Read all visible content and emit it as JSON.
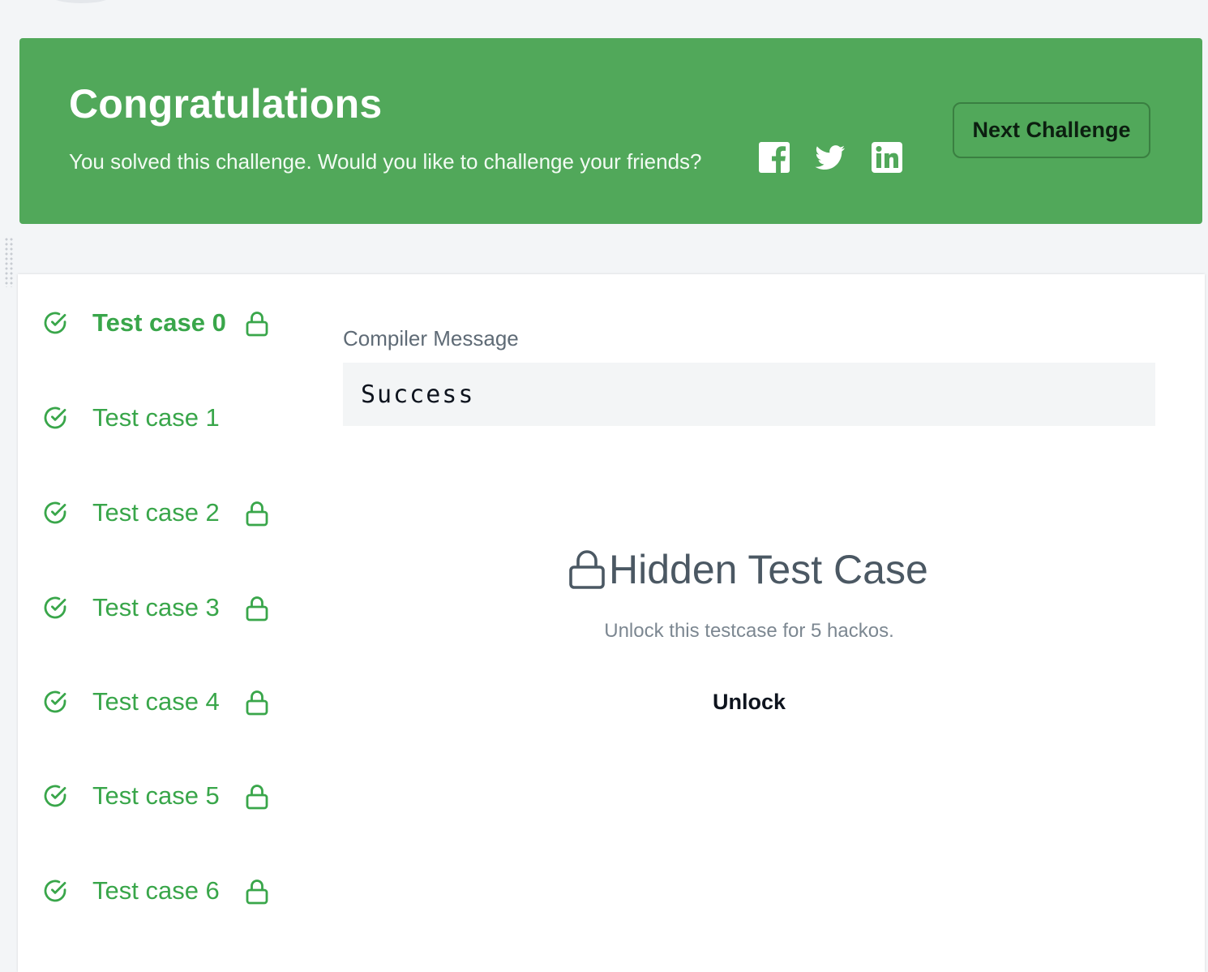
{
  "banner": {
    "title": "Congratulations",
    "subtitle": "You solved this challenge. Would you like to challenge your friends?",
    "next_button": "Next Challenge",
    "share_icons": [
      "facebook-icon",
      "twitter-icon",
      "linkedin-icon"
    ],
    "background_color": "#51a85a"
  },
  "test_cases": [
    {
      "label": "Test case 0",
      "passed": true,
      "locked": true,
      "active": true
    },
    {
      "label": "Test case 1",
      "passed": true,
      "locked": false,
      "active": false
    },
    {
      "label": "Test case 2",
      "passed": true,
      "locked": true,
      "active": false
    },
    {
      "label": "Test case 3",
      "passed": true,
      "locked": true,
      "active": false
    },
    {
      "label": "Test case 4",
      "passed": true,
      "locked": true,
      "active": false
    },
    {
      "label": "Test case 5",
      "passed": true,
      "locked": true,
      "active": false
    },
    {
      "label": "Test case 6",
      "passed": true,
      "locked": true,
      "active": false
    }
  ],
  "compiler": {
    "label": "Compiler Message",
    "message": "Success"
  },
  "hidden_case": {
    "title": "Hidden Test Case",
    "description": "Unlock this testcase for 5 hackos.",
    "unlock_button": "Unlock"
  },
  "colors": {
    "success_green": "#39a64a",
    "text_dark": "#0e141e",
    "muted": "#7c8791"
  }
}
